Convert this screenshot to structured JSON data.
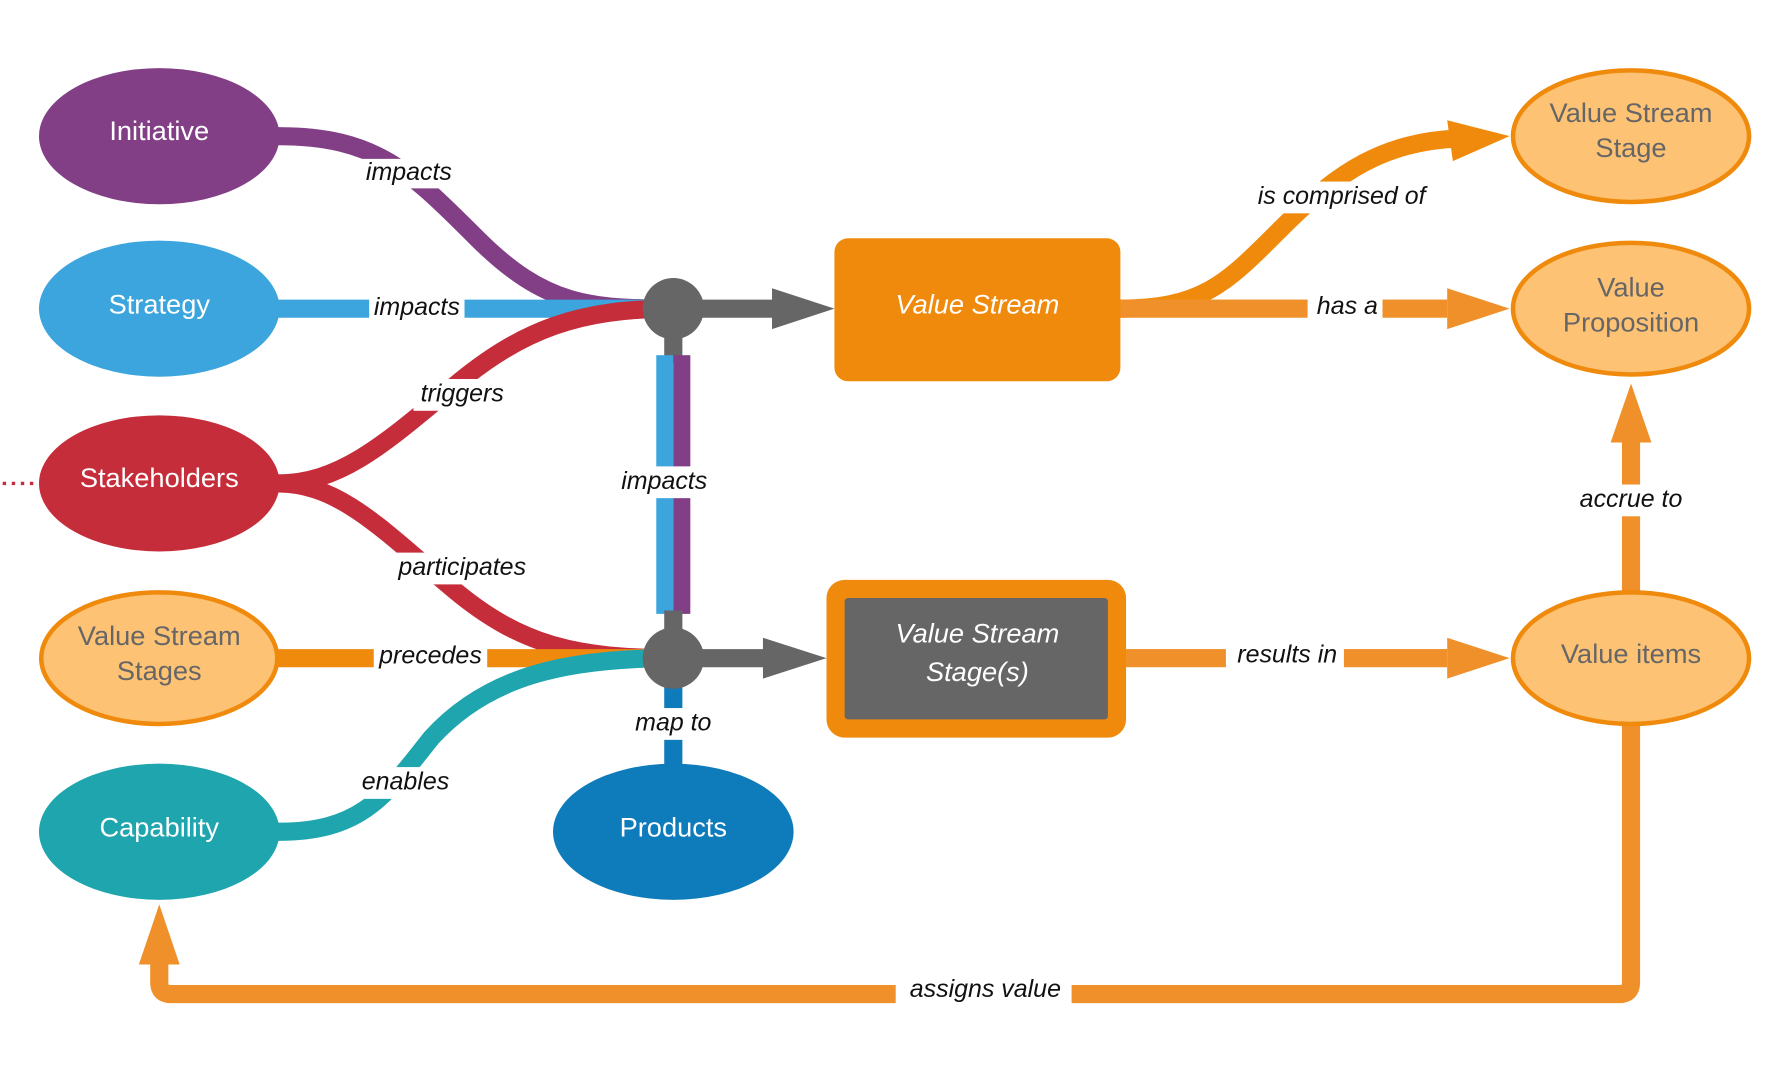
{
  "colors": {
    "initiative": "#823f86",
    "strategy": "#3ca5dd",
    "stakeholders": "#c62d3b",
    "capability": "#1fa5ad",
    "products": "#0e7bbb",
    "orange": "#ef8a0c",
    "light_orange": "#fdc274",
    "orange_line": "#f0902a",
    "hub_gray": "#666666"
  },
  "nodes": {
    "initiative": "Initiative",
    "strategy": "Strategy",
    "stakeholders": "Stakeholders",
    "vs_stages_line1": "Value Stream",
    "vs_stages_line2": "Stages",
    "capability": "Capability",
    "products": "Products",
    "value_stream": "Value Stream",
    "vs_stage_box_line1": "Value Stream",
    "vs_stage_box_line2": "Stage(s)",
    "vs_stage_line1": "Value Stream",
    "vs_stage_line2": "Stage",
    "value_prop_line1": "Value",
    "value_prop_line2": "Proposition",
    "value_items": "Value items"
  },
  "edges": {
    "initiative_impacts": "impacts",
    "strategy_impacts": "impacts",
    "stakeholders_triggers": "triggers",
    "stakeholders_participates": "participates",
    "vss_precedes": "precedes",
    "capability_enables": "enables",
    "hub_impacts": "impacts",
    "map_to": "map to",
    "is_comprised_of": "is comprised of",
    "has_a": "has a",
    "results_in": "results in",
    "accrue_to": "accrue to",
    "assigns_value": "assigns value"
  }
}
